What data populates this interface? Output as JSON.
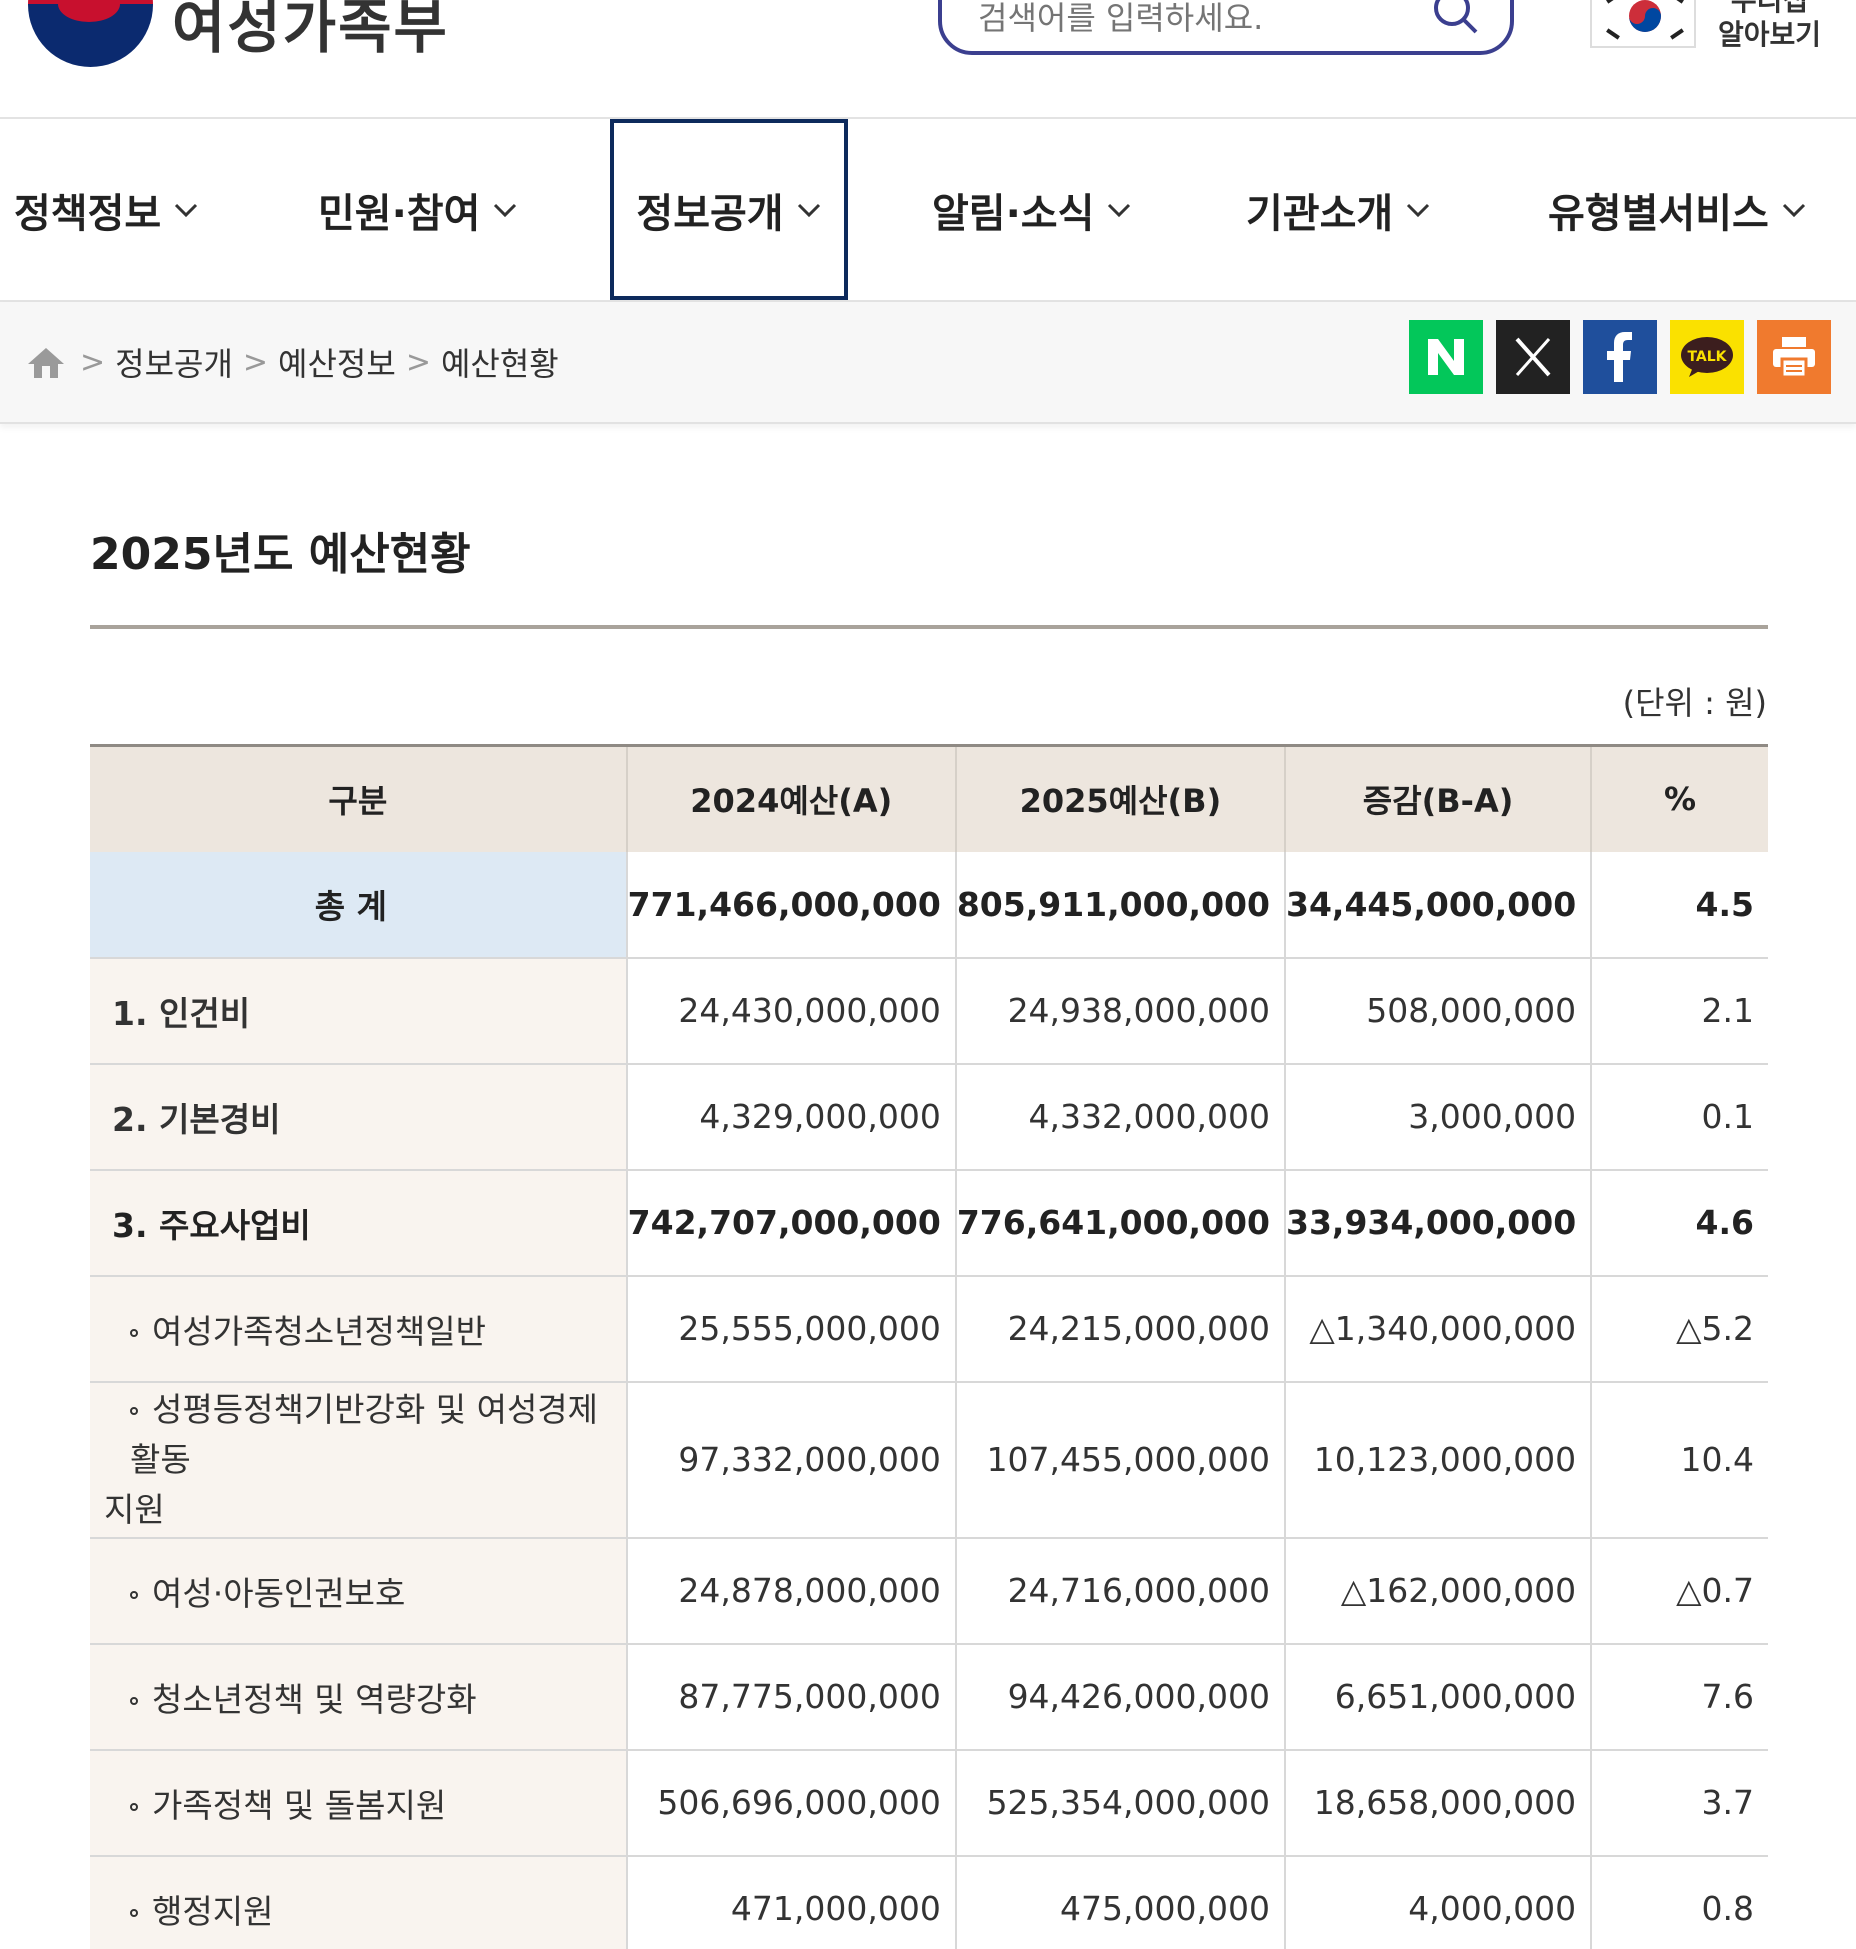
{
  "header": {
    "logo_text": "여성가족부",
    "search_placeholder": "검색어를 입력하세요.",
    "flag_label_1": "누리집",
    "flag_label_2": "알아보기"
  },
  "nav": {
    "items": [
      {
        "label": "정책정보"
      },
      {
        "label": "민원·참여"
      },
      {
        "label": "정보공개"
      },
      {
        "label": "알림·소식"
      },
      {
        "label": "기관소개"
      },
      {
        "label": "유형별서비스"
      }
    ],
    "active_index": 2
  },
  "breadcrumb": {
    "items": [
      "정보공개",
      "예산정보",
      "예산현황"
    ]
  },
  "share": [
    {
      "icon": "naver-icon",
      "label": "N",
      "color": "#03c75a"
    },
    {
      "icon": "x-icon",
      "label": "X",
      "color": "#222222"
    },
    {
      "icon": "facebook-icon",
      "label": "f",
      "color": "#1f4f9c"
    },
    {
      "icon": "kakaotalk-icon",
      "label": "TALK",
      "color": "#fae100"
    },
    {
      "icon": "print-icon",
      "label": "",
      "color": "#f07a2e"
    }
  ],
  "content": {
    "title": "2025년도 예산현황",
    "unit": "(단위 : 원)"
  },
  "table": {
    "headers": [
      "구분",
      "2024예산(A)",
      "2025예산(B)",
      "증감(B-A)",
      "%"
    ],
    "rows": [
      {
        "label": "총 계",
        "a": "771,466,000,000",
        "b": "805,911,000,000",
        "diff": "34,445,000,000",
        "pct": "4.5"
      },
      {
        "label": "1. 인건비",
        "a": "24,430,000,000",
        "b": "24,938,000,000",
        "diff": "508,000,000",
        "pct": "2.1"
      },
      {
        "label": "2. 기본경비",
        "a": "4,329,000,000",
        "b": "4,332,000,000",
        "diff": "3,000,000",
        "pct": "0.1"
      },
      {
        "label": "3. 주요사업비",
        "a": "742,707,000,000",
        "b": "776,641,000,000",
        "diff": "33,934,000,000",
        "pct": "4.6"
      },
      {
        "label": "여성가족청소년정책일반",
        "a": "25,555,000,000",
        "b": "24,215,000,000",
        "diff": "△1,340,000,000",
        "pct": "△5.2"
      },
      {
        "label": "성평등정책기반강화 및 여성경제활동지원",
        "label_line1": "성평등정책기반강화 및 여성경제활동",
        "label_line2": "지원",
        "a": "97,332,000,000",
        "b": "107,455,000,000",
        "diff": "10,123,000,000",
        "pct": "10.4"
      },
      {
        "label": "여성·아동인권보호",
        "a": "24,878,000,000",
        "b": "24,716,000,000",
        "diff": "△162,000,000",
        "pct": "△0.7"
      },
      {
        "label": "청소년정책 및 역량강화",
        "a": "87,775,000,000",
        "b": "94,426,000,000",
        "diff": "6,651,000,000",
        "pct": "7.6"
      },
      {
        "label": "가족정책 및 돌봄지원",
        "a": "506,696,000,000",
        "b": "525,354,000,000",
        "diff": "18,658,000,000",
        "pct": "3.7"
      },
      {
        "label": "행정지원",
        "a": "471,000,000",
        "b": "475,000,000",
        "diff": "4,000,000",
        "pct": "0.8"
      }
    ]
  }
}
